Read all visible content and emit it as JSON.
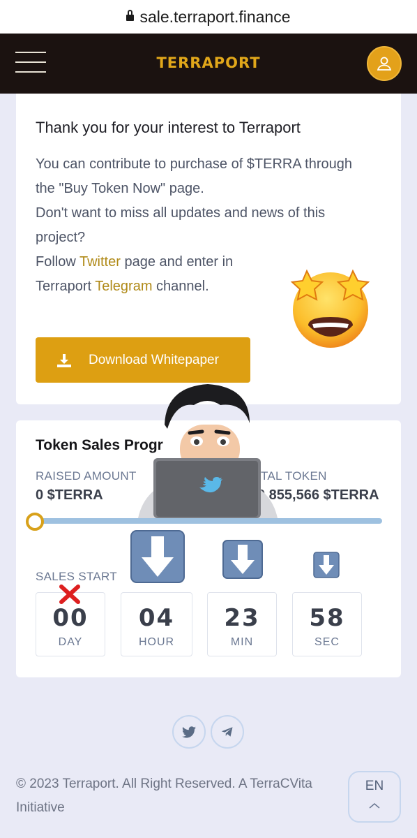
{
  "browser": {
    "url": "sale.terraport.finance"
  },
  "header": {
    "logo": "TERRAPORT"
  },
  "intro": {
    "title": "Thank you for your interest to Terraport",
    "line1": "You can contribute to purchase of $TERRA through",
    "line2": "the \"Buy Token Now\" page.",
    "line3": "Don't want to miss all updates and news of this",
    "line4": "project?",
    "line5_prefix": "Follow ",
    "line5_link": "Twitter",
    "line5_suffix": " page and enter in",
    "line6_prefix": "Terraport ",
    "line6_link": "Telegram",
    "line6_suffix": " channel.",
    "download_label": "Download Whitepaper"
  },
  "sales": {
    "title": "Token Sales Progress",
    "title_visible": "Token Sales Progr",
    "raised_label": "RAISED AMOUNT",
    "raised_value": "0 $TERRA",
    "total_label_visible": "TAL TOKEN",
    "total_value_visible": "0,855,566 $TERRA",
    "progress_fraction": 0,
    "start_label_visible": "SALES START",
    "countdown": [
      {
        "num": "00",
        "unit": "DAY"
      },
      {
        "num": "04",
        "unit": "HOUR"
      },
      {
        "num": "23",
        "unit": "MIN"
      },
      {
        "num": "58",
        "unit": "SEC"
      }
    ]
  },
  "footer": {
    "copyright": "© 2023 Terraport. All Right Reserved. A TerraCVita Initiative",
    "language": "EN"
  },
  "colors": {
    "accent": "#dd9f12",
    "header_bg": "#1b1210",
    "page_bg": "#e9eaf6",
    "link": "#b08a18",
    "progress_track": "#9ec1e0"
  },
  "icons": [
    "lock-icon",
    "hamburger-menu-icon",
    "user-icon",
    "download-icon",
    "star-struck-emoji",
    "memoji-laptop-sticker",
    "down-arrow-emoji",
    "red-x-mark",
    "twitter-icon",
    "telegram-icon",
    "chevron-up-icon"
  ]
}
